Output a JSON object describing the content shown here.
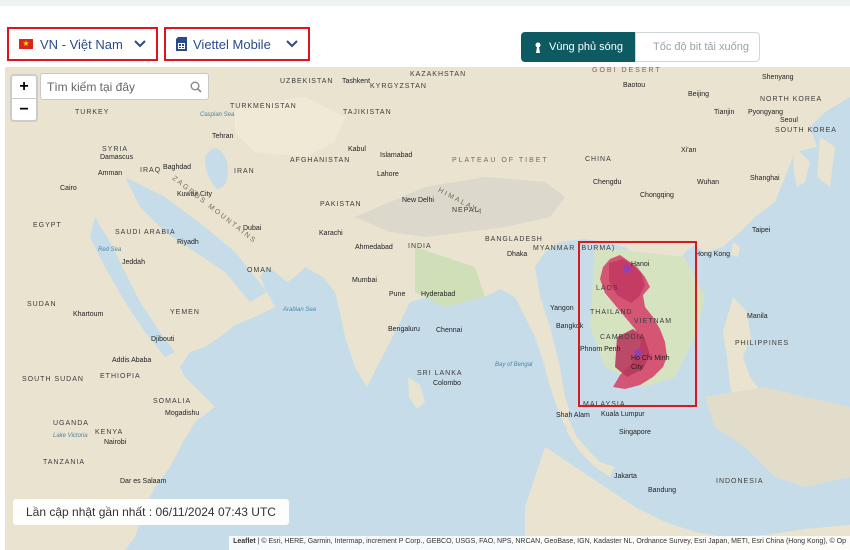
{
  "country_select": {
    "value": "VN - Việt Nam"
  },
  "carrier_select": {
    "value": "Viettel Mobile"
  },
  "mode_toggle": {
    "coverage_label": "Vùng phủ sóng",
    "speed_label": "Tốc độ bit tải xuống"
  },
  "map": {
    "search_placeholder": "Tìm kiếm tại đây",
    "zoom_in": "+",
    "zoom_out": "−",
    "last_updated": "Lần cập nhật gần nhất : 06/11/2024 07:43 UTC",
    "attribution_leaflet": "Leaflet",
    "attribution_text": "| © Esri, HERE, Garmin, Intermap, increment P Corp., GEBCO, USGS, FAO, NPS, NRCAN, GeoBase, IGN, Kadaster NL, Ordnance Survey, Esri Japan, METI, Esri China (Hong Kong), © Op",
    "labels": {
      "uzbekistan": "UZBEKISTAN",
      "tashkent": "Tashkent",
      "kyrgyzstan": "KYRGYZSTAN",
      "kazakhstan": "KAZAKHSTAN",
      "gobi": "GOBI DESERT",
      "shenyang": "Shenyang",
      "turkey": "TURKEY",
      "turkmenistan": "TURKMENISTAN",
      "tajikistan": "TAJIKISTAN",
      "baotou": "Baotou",
      "beijing": "Beijing",
      "north_korea": "NORTH KOREA",
      "tianjin": "Tianjin",
      "pyongyang": "Pyongyang",
      "seoul": "Seoul",
      "south_korea": "SOUTH KOREA",
      "caspian": "Caspian Sea",
      "tehran": "Tehran",
      "syria": "SYRIA",
      "damascus": "Damascus",
      "amman": "Amman",
      "iraq": "IRAQ",
      "baghdad": "Baghdad",
      "zagros": "ZAGROS MOUNTAINS",
      "kabul": "Kabul",
      "islamabad": "Islamabad",
      "afghanistan": "AFGHANISTAN",
      "plateau": "PLATEAU OF TIBET",
      "china": "CHINA",
      "xian": "Xi'an",
      "lahore": "Lahore",
      "iran": "IRAN",
      "cairo": "Cairo",
      "kuwait": "Kuwait City",
      "himalaya": "HIMALAYA",
      "chengdu": "Chengdu",
      "wuhan": "Wuhan",
      "shanghai": "Shanghai",
      "egypt": "EGYPT",
      "pakistan": "PAKISTAN",
      "new_delhi": "New Delhi",
      "nepal": "NEPAL",
      "chongqing": "Chongqing",
      "saudi": "SAUDI ARABIA",
      "riyadh": "Riyadh",
      "dubai": "Dubai",
      "karachi": "Karachi",
      "taipei": "Taipei",
      "red_sea": "Red Sea",
      "bangladesh": "BANGLADESH",
      "myanmar": "MYANMAR (BURMA)",
      "jeddah": "Jeddah",
      "oman": "OMAN",
      "ahmedabad": "Ahmedabad",
      "india": "INDIA",
      "dhaka": "Dhaka",
      "hanoi": "Hanoi",
      "hong_kong": "Hong Kong",
      "mumbai": "Mumbai",
      "pune": "Pune",
      "hyderabad": "Hyderabad",
      "laos": "LAOS",
      "sudan": "SUDAN",
      "khartoum": "Khartoum",
      "yemen": "YEMEN",
      "arabian_sea": "Arabian Sea",
      "yangon": "Yangon",
      "thailand": "THAILAND",
      "manila": "Manila",
      "vietnam": "VIETNAM",
      "bengaluru": "Bengaluru",
      "chennai": "Chennai",
      "bangkok": "Bangkok",
      "cambodia": "CAMBODIA",
      "djibouti": "Djibouti",
      "philippines": "PHILIPPINES",
      "addis": "Addis Ababa",
      "phnom_penh": "Phnom Penh",
      "hcmc": "Ho Chi Minh City",
      "sri_lanka": "SRI LANKA",
      "colombo": "Colombo",
      "south_sudan": "SOUTH SUDAN",
      "ethiopia": "ETHIOPIA",
      "bay_of_bengal": "Bay of Bengal",
      "somalia": "SOMALIA",
      "mogadishu": "Mogadishu",
      "malaysia": "MALAYSIA",
      "shah_alam": "Shah Alam",
      "kuala_lumpur": "Kuala Lumpur",
      "uganda": "UGANDA",
      "kenya": "KENYA",
      "nairobi": "Nairobi",
      "lake_victoria": "Lake Victoria",
      "singapore": "Singapore",
      "tanzania": "TANZANIA",
      "dar": "Dar es Salaam",
      "jakarta": "Jakarta",
      "indonesia": "INDONESIA",
      "bandung": "Bandung"
    }
  },
  "colors": {
    "highlight": "#d71920",
    "active_toggle": "#0d5a62",
    "coverage": "#d44a6e",
    "select_text": "#2a4a8a"
  }
}
